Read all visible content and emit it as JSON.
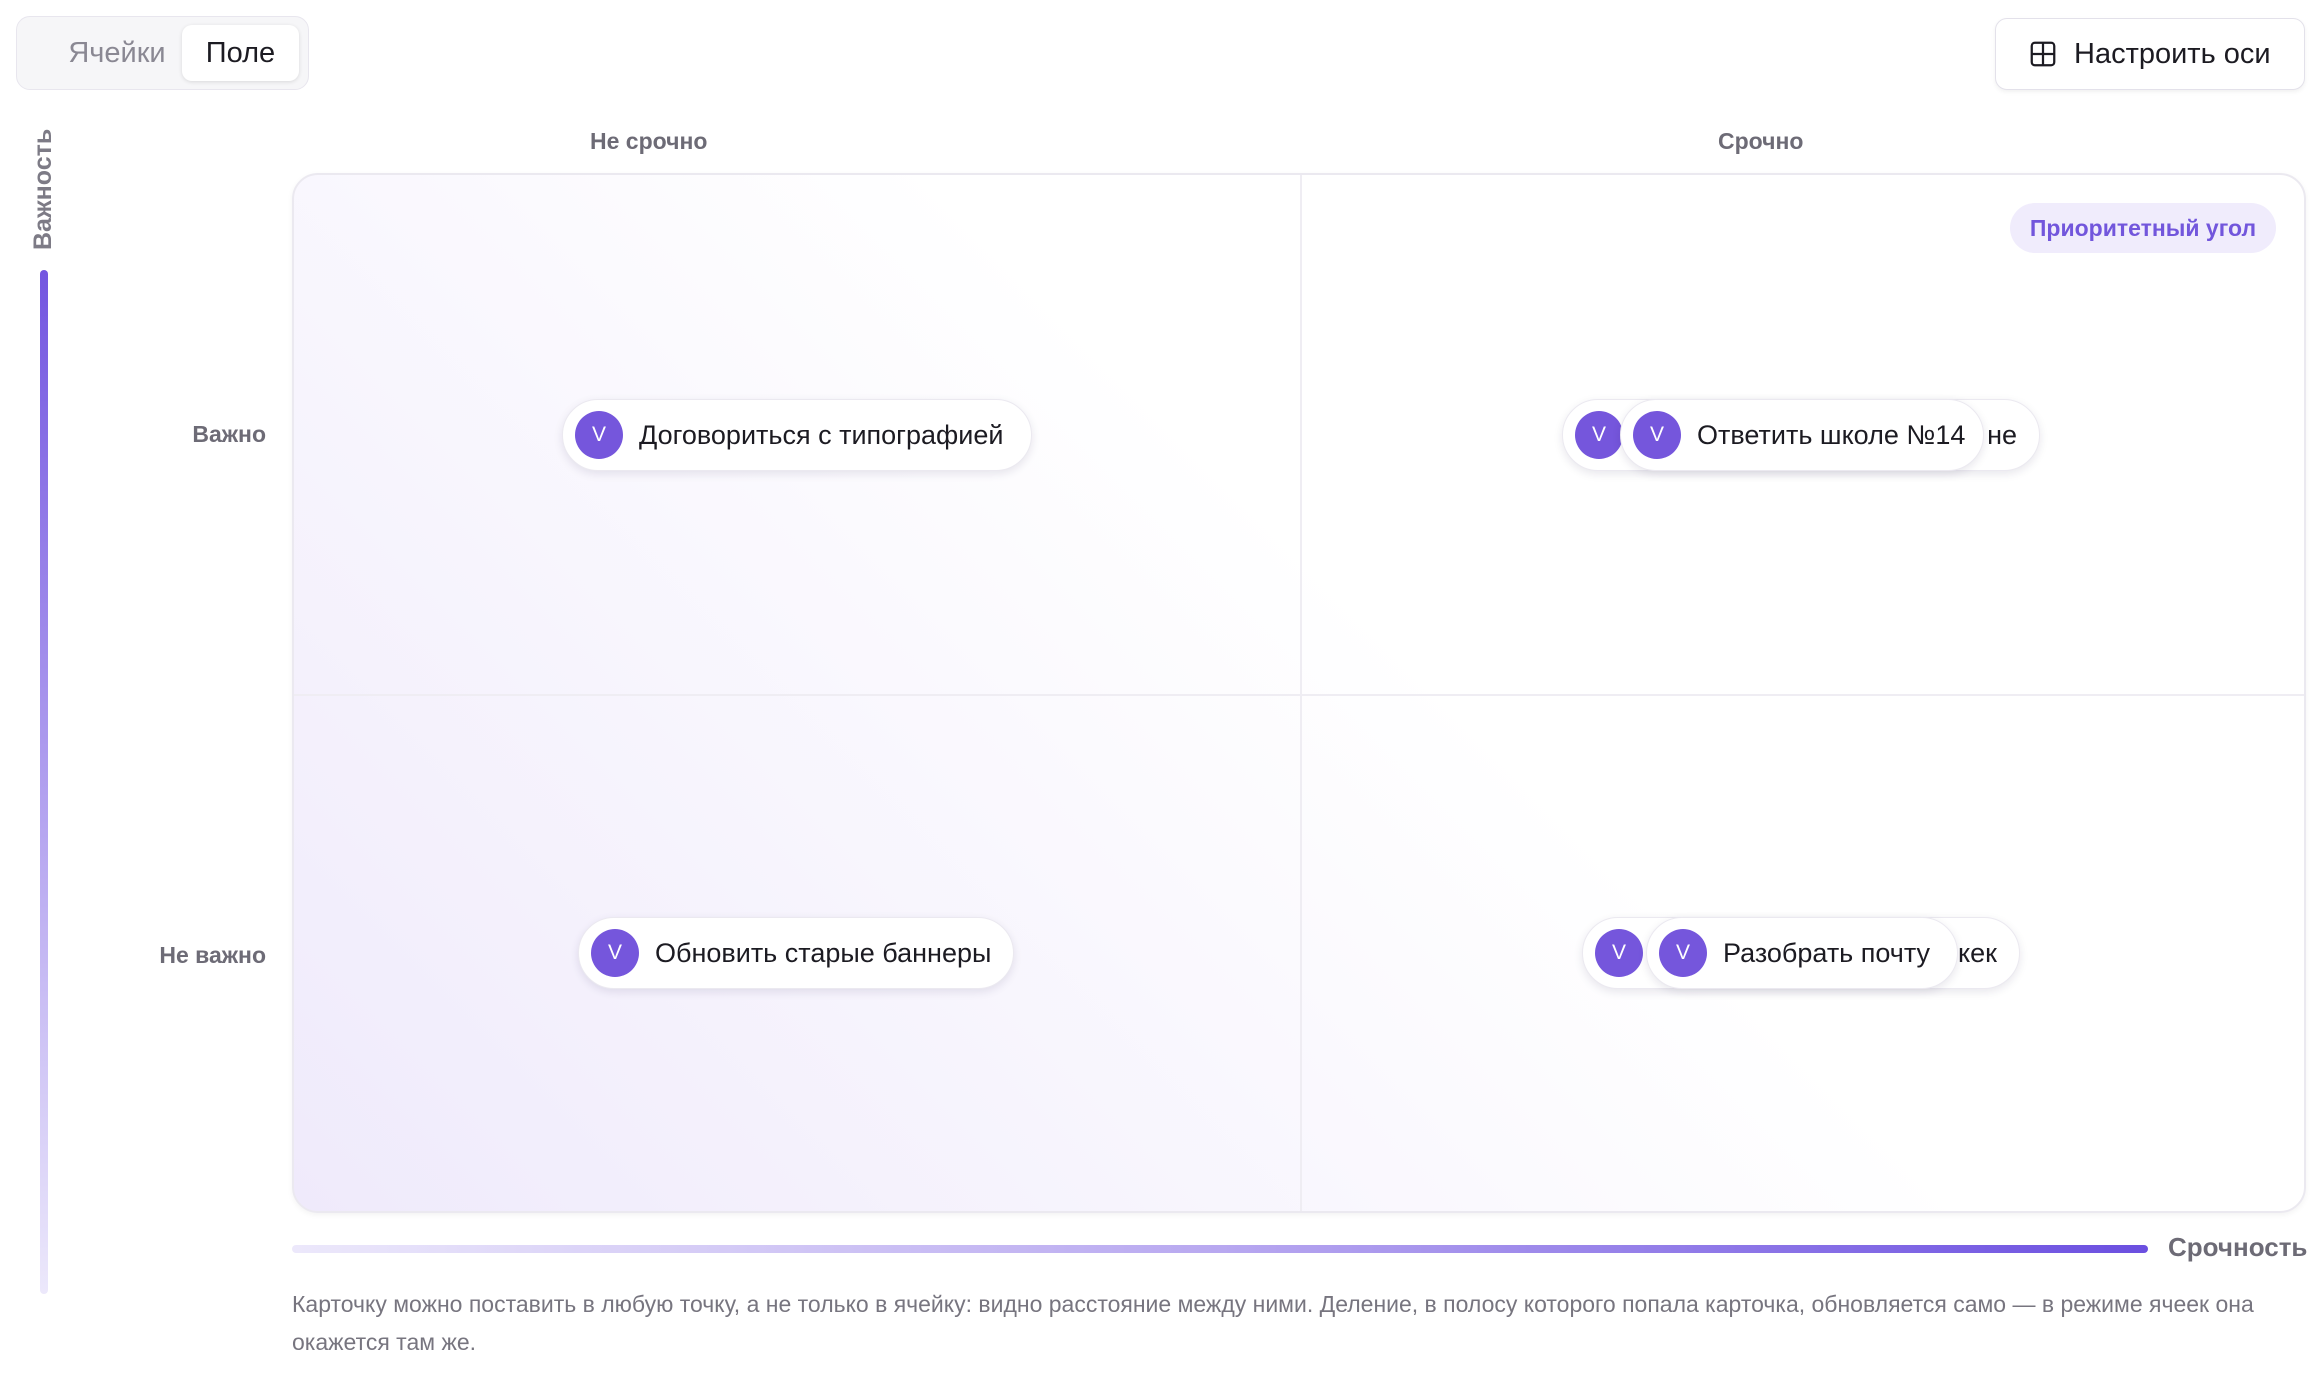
{
  "view_switch": {
    "cells": "Ячейки",
    "field": "Поле",
    "selected": "Поле"
  },
  "axes_button": {
    "label": "Настроить оси",
    "icon": "grid-icon"
  },
  "axes": {
    "importance": "Важность",
    "urgency": "Срочность",
    "columns": [
      "Не срочно",
      "Срочно"
    ],
    "rows": [
      "Важно",
      "Не важно"
    ]
  },
  "priority_badge": "Приоритетный угол",
  "cards": [
    {
      "avatar": "V",
      "title": "Договориться с типографией",
      "quadrant": "Важно / Не срочно"
    },
    {
      "avatar": "V",
      "title": "Ответить школе №14",
      "quadrant": "Важно / Срочно"
    },
    {
      "avatar": "V",
      "title": "не",
      "quadrant": "Важно / Срочно",
      "partially_hidden": true
    },
    {
      "avatar": "V",
      "title": "Обновить старые баннеры",
      "quadrant": "Не важно / Не срочно"
    },
    {
      "avatar": "V",
      "title": "Разобрать почту",
      "quadrant": "Не важно / Срочно"
    },
    {
      "avatar": "V",
      "title": "кек",
      "quadrant": "Не важно / Срочно",
      "partially_hidden": true
    }
  ],
  "note": "Карточку можно поставить в любую точку, а не только в ячейку: видно расстояние между ними. Деление, в полосу которого попала карточка, обновляется само — в режиме ячеек она окажется там же.",
  "colors": {
    "accent": "#7556DC",
    "badge_bg": "#F0ECFC"
  }
}
